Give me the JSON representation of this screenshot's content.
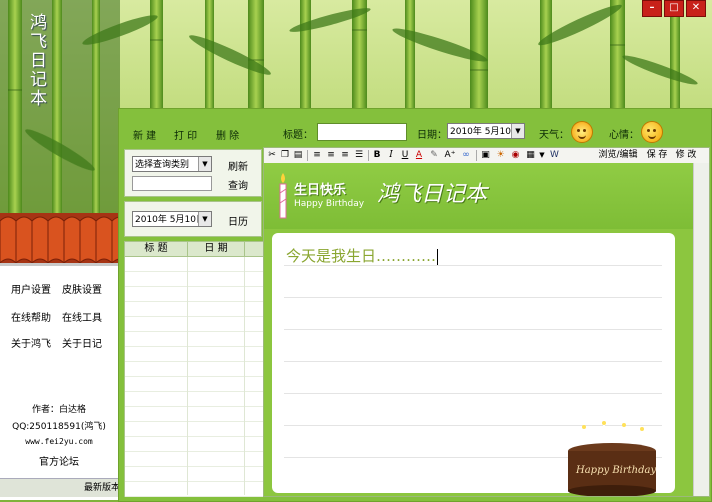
{
  "window": {
    "title": "鸿飞日记本",
    "btn_min": "–",
    "btn_max": "□",
    "btn_close": "✕"
  },
  "colors": {
    "accent_green": "#84c03c",
    "close_red": "#c8211a",
    "note_text": "#8aa630"
  },
  "left_menu": {
    "items": [
      "用户设置",
      "皮肤设置",
      "在线帮助",
      "在线工具",
      "关于鸿飞",
      "关于日记"
    ],
    "author": "作者：白达格",
    "qq": "QQ:250118591(鸿飞)",
    "site": "www.fei2yu.com",
    "forum": "官方论坛",
    "bottom_text": "最新版本"
  },
  "toolbar": {
    "new": "新 建",
    "print": "打 印",
    "delete": "删 除",
    "title_label": "标题：",
    "title_value": "",
    "date_label": "日期：",
    "date_value": "2010年 5月10日",
    "weather_label": "天气：",
    "weather_icon": "sun-icon",
    "mood_label": "心情：",
    "mood_icon": "smiley-icon"
  },
  "search": {
    "category_select": "选择查询类别",
    "refresh": "刷新",
    "query": "查询",
    "query_value": "",
    "date_value": "2010年 5月10日",
    "calendar": "日历"
  },
  "list": {
    "col_title": "标 题",
    "col_date": "日 期",
    "rows": []
  },
  "editor_toolbar": {
    "browse_edit": "浏览/编辑",
    "save": "保 存",
    "modify": "修 改",
    "bold": "B",
    "italic": "I",
    "underline": "U",
    "font_color": "A"
  },
  "paper": {
    "badge_cn": "生日快乐",
    "badge_en": "Happy Birthday",
    "banner_title": "鸿飞日记本",
    "content": "今天是我生日…………",
    "cake_text": "Happy Birthday"
  }
}
